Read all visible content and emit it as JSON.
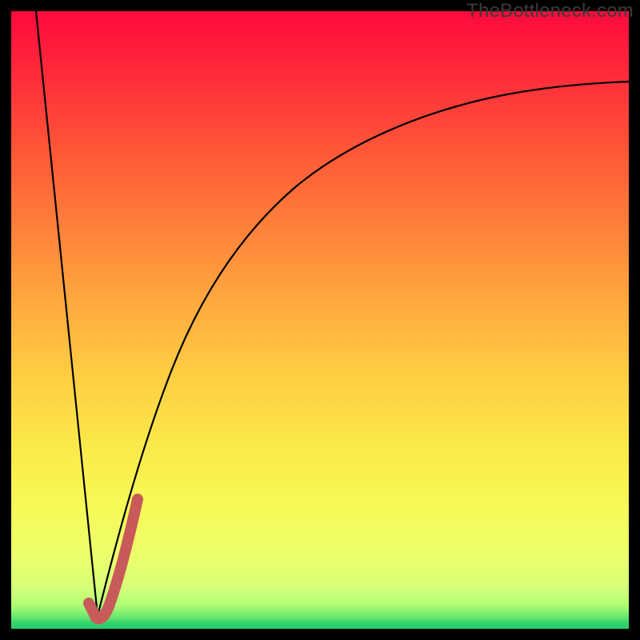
{
  "watermark": {
    "text": "TheBottleneck.com"
  },
  "colors": {
    "frame": "#000000",
    "curve": "#000000",
    "highlight": "#c95a5a",
    "gradient_stops": [
      "#ff0a3c",
      "#ff2a3a",
      "#ff5538",
      "#ff7d3a",
      "#ffa53e",
      "#ffcb42",
      "#fbe84a",
      "#f6fa56",
      "#edff6a",
      "#d9ff78",
      "#b4ff75",
      "#6fe86e",
      "#34d66c",
      "#2ac96a"
    ]
  },
  "chart_data": {
    "type": "line",
    "title": "",
    "xlabel": "",
    "ylabel": "",
    "xlim": [
      0,
      100
    ],
    "ylim": [
      0,
      100
    ],
    "grid": false,
    "legend": false,
    "note": "Axes are unlabeled in the source image; coordinates below are normalized 0–100 in plot-area space (origin bottom-left). Values are visual estimates from the raster.",
    "series": [
      {
        "name": "left-descending-line",
        "x": [
          4,
          14
        ],
        "y": [
          100,
          2
        ]
      },
      {
        "name": "right-saturating-curve",
        "x": [
          14,
          16,
          18,
          20,
          23,
          26,
          30,
          35,
          40,
          46,
          53,
          61,
          70,
          80,
          90,
          100
        ],
        "y": [
          2,
          10,
          18,
          26,
          36,
          44,
          53,
          61,
          67,
          72,
          76,
          80,
          83,
          85,
          87,
          88
        ]
      },
      {
        "name": "highlight-segment",
        "stroke": "#c95a5a",
        "stroke_width_px": 14,
        "x": [
          12.5,
          14.5,
          16.5,
          18.5,
          20.5
        ],
        "y": [
          4,
          2,
          6,
          13,
          21
        ]
      }
    ]
  }
}
